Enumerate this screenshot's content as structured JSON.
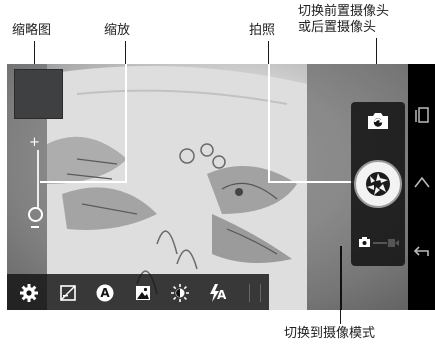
{
  "annotations": {
    "thumbnail": "缩略图",
    "zoom": "缩放",
    "shoot": "拍照",
    "switch_camera_line1": "切换前置摄像头",
    "switch_camera_line2": "或后置摄像头",
    "switch_video": "切换到摄像模式"
  },
  "zoom": {
    "plus": "+",
    "level": 0
  },
  "toolbar": {
    "items": [
      {
        "name": "settings",
        "icon": "gear-icon"
      },
      {
        "name": "exposure",
        "icon": "exposure-icon"
      },
      {
        "name": "scene-mode",
        "icon": "scene-auto-icon",
        "glyph": "A"
      },
      {
        "name": "color-effects",
        "icon": "image-effects-icon"
      },
      {
        "name": "white-balance",
        "icon": "white-balance-icon"
      },
      {
        "name": "flash",
        "icon": "flash-auto-icon",
        "glyph": "A"
      }
    ]
  },
  "right_controls": {
    "switch_camera_icon": "switch-camera-icon",
    "shutter_icon": "shutter-icon",
    "mode": "camera"
  },
  "navigation": [
    "recent-apps-icon",
    "home-icon",
    "back-icon"
  ],
  "colors": {
    "toolbar_bg": "#141414",
    "accent": "#ffffff",
    "thumbnail": "#3f4042"
  }
}
